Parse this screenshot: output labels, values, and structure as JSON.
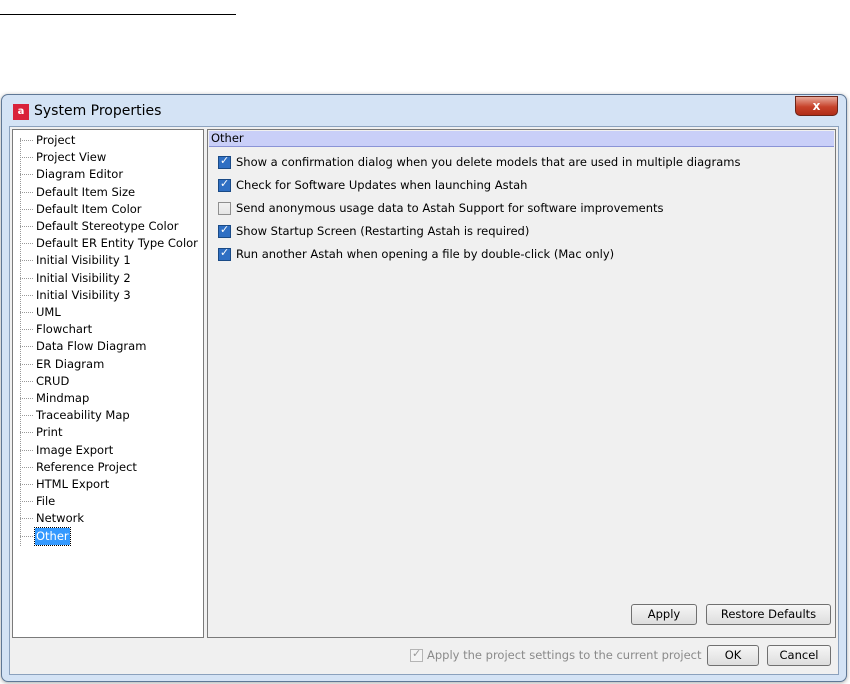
{
  "window": {
    "title": "System Properties",
    "app_icon": "a",
    "close": "x"
  },
  "tree": {
    "items": [
      "Project",
      "Project View",
      "Diagram Editor",
      "Default Item Size",
      "Default Item Color",
      "Default Stereotype Color",
      "Default ER Entity Type Color",
      "Initial Visibility 1",
      "Initial Visibility 2",
      "Initial Visibility 3",
      "UML",
      "Flowchart",
      "Data Flow Diagram",
      "ER Diagram",
      "CRUD",
      "Mindmap",
      "Traceability Map",
      "Print",
      "Image Export",
      "Reference Project",
      "HTML Export",
      "File",
      "Network",
      "Other"
    ],
    "selected": "Other"
  },
  "panel": {
    "header": "Other",
    "options": [
      {
        "label": "Show a confirmation dialog when you delete models that are used in multiple diagrams",
        "checked": true
      },
      {
        "label": "Check for Software Updates when launching Astah",
        "checked": true
      },
      {
        "label": "Send anonymous usage data to Astah Support for software improvements",
        "checked": false
      },
      {
        "label": "Show Startup Screen (Restarting Astah is required)",
        "checked": true
      },
      {
        "label": "Run another Astah when opening a file by double-click (Mac only)",
        "checked": true
      }
    ],
    "apply_label": "Apply",
    "restore_label": "Restore Defaults"
  },
  "footer": {
    "apply_project_label": "Apply the project settings to the current project",
    "apply_project_checked": true,
    "ok_label": "OK",
    "cancel_label": "Cancel"
  }
}
